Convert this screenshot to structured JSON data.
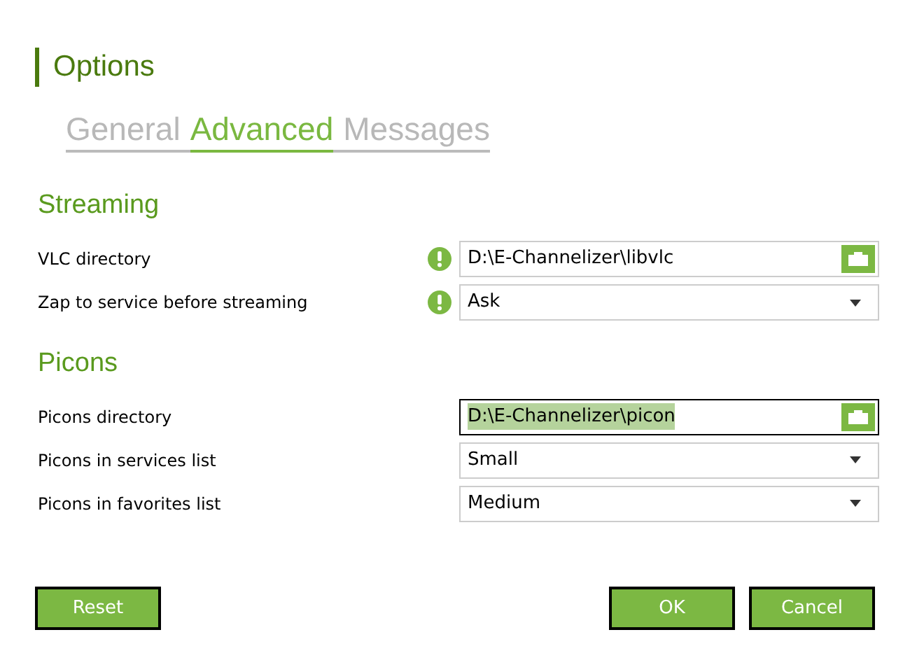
{
  "title": "Options",
  "tabs": [
    {
      "label": "General",
      "selected": false
    },
    {
      "label": "Advanced",
      "selected": true
    },
    {
      "label": "Messages",
      "selected": false
    }
  ],
  "sections": [
    {
      "heading": "Streaming",
      "rows": [
        {
          "kind": "path",
          "label": "VLC directory",
          "value": "D:\\E-Channelizer\\libvlc",
          "warning": true,
          "focused": false
        },
        {
          "kind": "select",
          "label": "Zap to service before streaming",
          "value": "Ask",
          "warning": true,
          "focused": false
        }
      ]
    },
    {
      "heading": "Picons",
      "rows": [
        {
          "kind": "path",
          "label": "Picons directory",
          "value": "D:\\E-Channelizer\\picon",
          "warning": false,
          "focused": true
        },
        {
          "kind": "select",
          "label": "Picons in services list",
          "value": "Small",
          "warning": false,
          "focused": false
        },
        {
          "kind": "select",
          "label": "Picons in favorites list",
          "value": "Medium",
          "warning": false,
          "focused": false
        }
      ]
    }
  ],
  "buttons": {
    "left": [
      "Reset"
    ],
    "right": [
      "OK",
      "Cancel"
    ]
  }
}
